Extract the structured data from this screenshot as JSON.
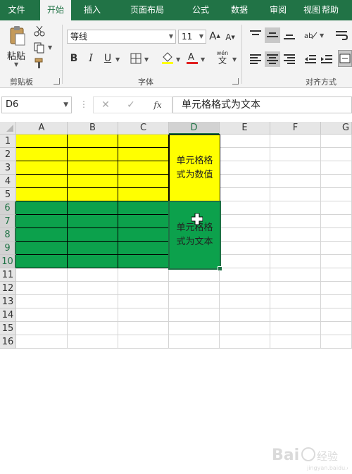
{
  "menu": {
    "tabs": [
      "文件",
      "开始",
      "插入",
      "页面布局",
      "公式",
      "数据",
      "审阅",
      "视图",
      "帮助"
    ],
    "active_index": 1
  },
  "ribbon": {
    "clipboard": {
      "paste_label": "粘贴",
      "group_label": "剪贴板"
    },
    "font": {
      "font_name": "等线",
      "font_size": "11",
      "group_label": "字体",
      "grow": "A",
      "shrink": "A",
      "bold": "B",
      "italic": "I",
      "underline": "U",
      "phonetic_top": "wén",
      "phonetic_bottom": "文"
    },
    "alignment": {
      "group_label": "对齐方式"
    }
  },
  "formula_bar": {
    "name_box": "D6",
    "fx": "fx",
    "content": "单元格格式为文本"
  },
  "sheet": {
    "columns": [
      "A",
      "B",
      "C",
      "D",
      "E",
      "F",
      "G"
    ],
    "selected_column": "D",
    "rows": [
      "1",
      "2",
      "3",
      "4",
      "5",
      "6",
      "7",
      "8",
      "9",
      "10",
      "11",
      "12",
      "13",
      "14",
      "15",
      "16"
    ],
    "selected_rows": [
      "6",
      "7",
      "8",
      "9",
      "10"
    ],
    "merged_d1_d5": "单元格格式为数值",
    "merged_d6_d10": "单元格格式为文本",
    "active_cell": "D6"
  },
  "colors": {
    "excel_green": "#217346",
    "yellow_fill": "#ffff00",
    "green_fill": "#0ca14c"
  },
  "watermark": {
    "text": "Baidu 经验"
  }
}
